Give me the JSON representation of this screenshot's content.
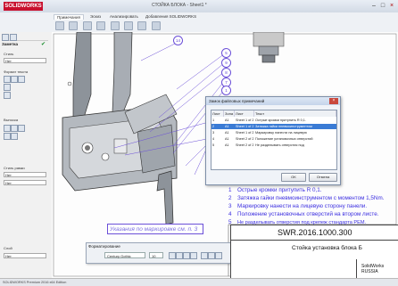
{
  "app": {
    "logo": "SOLIDWORKS",
    "title": "СТОЙКА БЛОКА - Sheet1 *"
  },
  "ribbon": {
    "tabs": [
      "Примечания",
      "Эскиз",
      "Анализировать",
      "Добавления SOLIDWORKS"
    ],
    "active_tab": 0
  },
  "panel": {
    "header": "Заметка",
    "sections": [
      {
        "label": "Стиль"
      },
      {
        "label": "Формат текста"
      },
      {
        "label": "Выноска"
      },
      {
        "label": "Стиль рамки"
      },
      {
        "label": "Слой"
      }
    ],
    "field_value": "Нет"
  },
  "dialog": {
    "title": "Замок файловых примечаний",
    "columns": [
      "Лист",
      "Зона",
      "Лист",
      "Текст"
    ],
    "rows": [
      {
        "c1": "1",
        "c2": "A1",
        "c3": "Sheet 1 of 2",
        "c4": "Острые кромки притупить R 0,1.",
        "selected": false
      },
      {
        "c1": "2",
        "c2": "A1",
        "c3": "Sheet 1 of 2",
        "c4": "Затяжка гайки пневмоинструментом",
        "selected": true
      },
      {
        "c1": "3",
        "c2": "A1",
        "c3": "Sheet 1 of 2",
        "c4": "Маркировку нанести на лицевую",
        "selected": false
      },
      {
        "c1": "4",
        "c2": "A1",
        "c3": "Sheet 2 of 2",
        "c4": "Положение установочных отверстий",
        "selected": false
      },
      {
        "c1": "5",
        "c2": "A1",
        "c3": "Sheet 2 of 2",
        "c4": "Не разделывать отверстия под",
        "selected": false
      }
    ],
    "ok_label": "OK",
    "cancel_label": "Отмена"
  },
  "notes": [
    {
      "num": "1",
      "text": "Острые кромки притупить R 0,1."
    },
    {
      "num": "2",
      "text": "Затяжка гайки пневмоинструментом с моментом 1,5Nm."
    },
    {
      "num": "3",
      "text": "Маркировку нанести на лицевую сторону панели."
    },
    {
      "num": "4",
      "text": "Положение установочных отверстий на втором листе."
    },
    {
      "num": "5",
      "text": "Не разделывать отверстия под крепеж стандарта PEM."
    }
  ],
  "annotation": {
    "text": "Указания по маркировке см. п. 3"
  },
  "format_toolbar": {
    "title": "Форматирование",
    "font": "Century Gothic",
    "size": "10"
  },
  "title_block": {
    "drawing_number": "SWR.2016.1000.300",
    "title": "Стойка установка блока Б",
    "company_line1": "SolidWorks",
    "company_line2": "RUSSIA"
  },
  "balloons": [
    "14",
    "5",
    "9",
    "8",
    "7",
    "1",
    "3"
  ],
  "status": {
    "text": "SOLIDWORKS Premium 2016 x64 Edition"
  },
  "colors": {
    "note_text": "#3b2ee0",
    "accent": "#c8102e",
    "selection": "#3a7bd5"
  }
}
